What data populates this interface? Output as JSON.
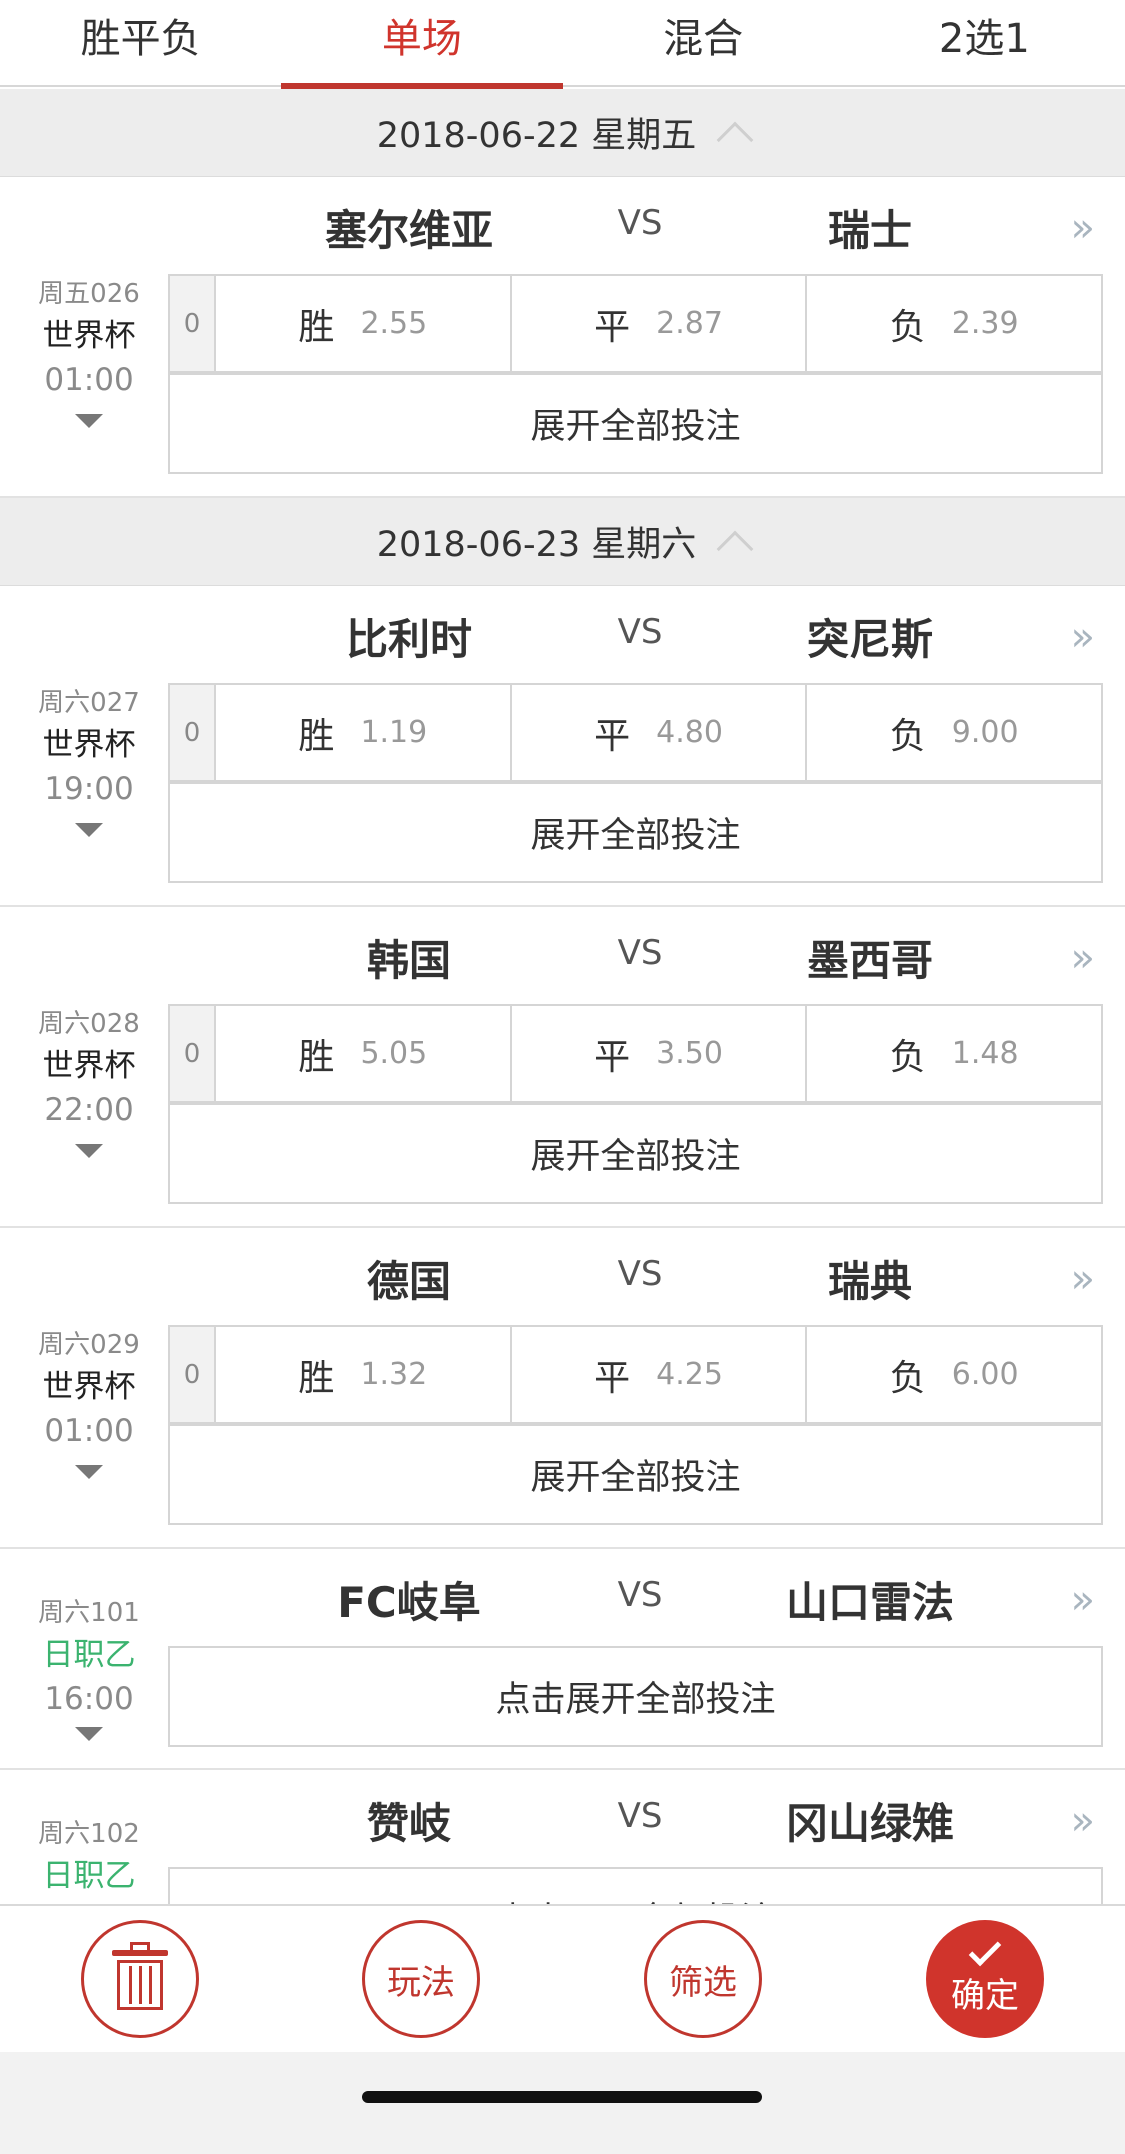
{
  "tabs": [
    {
      "label": "胜平负"
    },
    {
      "label": "单场"
    },
    {
      "label": "混合"
    },
    {
      "label": "2选1"
    }
  ],
  "active_tab": "单场",
  "groups": [
    {
      "date": "2018-06-22 星期五",
      "matches": [
        {
          "code": "周五026",
          "league": "世界杯",
          "time": "01:00",
          "home": "塞尔维亚",
          "vs": "VS",
          "away": "瑞士",
          "handicap": "0",
          "odds": [
            {
              "label": "胜",
              "value": "2.55"
            },
            {
              "label": "平",
              "value": "2.87"
            },
            {
              "label": "负",
              "value": "2.39"
            }
          ],
          "expand": "展开全部投注"
        }
      ]
    },
    {
      "date": "2018-06-23 星期六",
      "matches": [
        {
          "code": "周六027",
          "league": "世界杯",
          "time": "19:00",
          "home": "比利时",
          "vs": "VS",
          "away": "突尼斯",
          "handicap": "0",
          "odds": [
            {
              "label": "胜",
              "value": "1.19"
            },
            {
              "label": "平",
              "value": "4.80"
            },
            {
              "label": "负",
              "value": "9.00"
            }
          ],
          "expand": "展开全部投注"
        },
        {
          "code": "周六028",
          "league": "世界杯",
          "time": "22:00",
          "home": "韩国",
          "vs": "VS",
          "away": "墨西哥",
          "handicap": "0",
          "odds": [
            {
              "label": "胜",
              "value": "5.05"
            },
            {
              "label": "平",
              "value": "3.50"
            },
            {
              "label": "负",
              "value": "1.48"
            }
          ],
          "expand": "展开全部投注"
        },
        {
          "code": "周六029",
          "league": "世界杯",
          "time": "01:00",
          "home": "德国",
          "vs": "VS",
          "away": "瑞典",
          "handicap": "0",
          "odds": [
            {
              "label": "胜",
              "value": "1.32"
            },
            {
              "label": "平",
              "value": "4.25"
            },
            {
              "label": "负",
              "value": "6.00"
            }
          ],
          "expand": "展开全部投注"
        },
        {
          "code": "周六101",
          "league": "日职乙",
          "time": "16:00",
          "home": "FC岐阜",
          "vs": "VS",
          "away": "山口雷法",
          "expand": "点击展开全部投注"
        },
        {
          "code": "周六102",
          "league": "日职乙",
          "home": "赞岐",
          "vs": "VS",
          "away": "冈山绿雉",
          "expand": "点击展开全部投注"
        }
      ]
    }
  ],
  "more_glyph": "»",
  "toolbar": {
    "trash_icon": "trash-icon",
    "play_label": "玩法",
    "filter_label": "筛选",
    "confirm_label": "确定"
  },
  "colors": {
    "accent": "#d0342c",
    "league_green": "#3bb36f",
    "header_bg": "#ededed"
  }
}
